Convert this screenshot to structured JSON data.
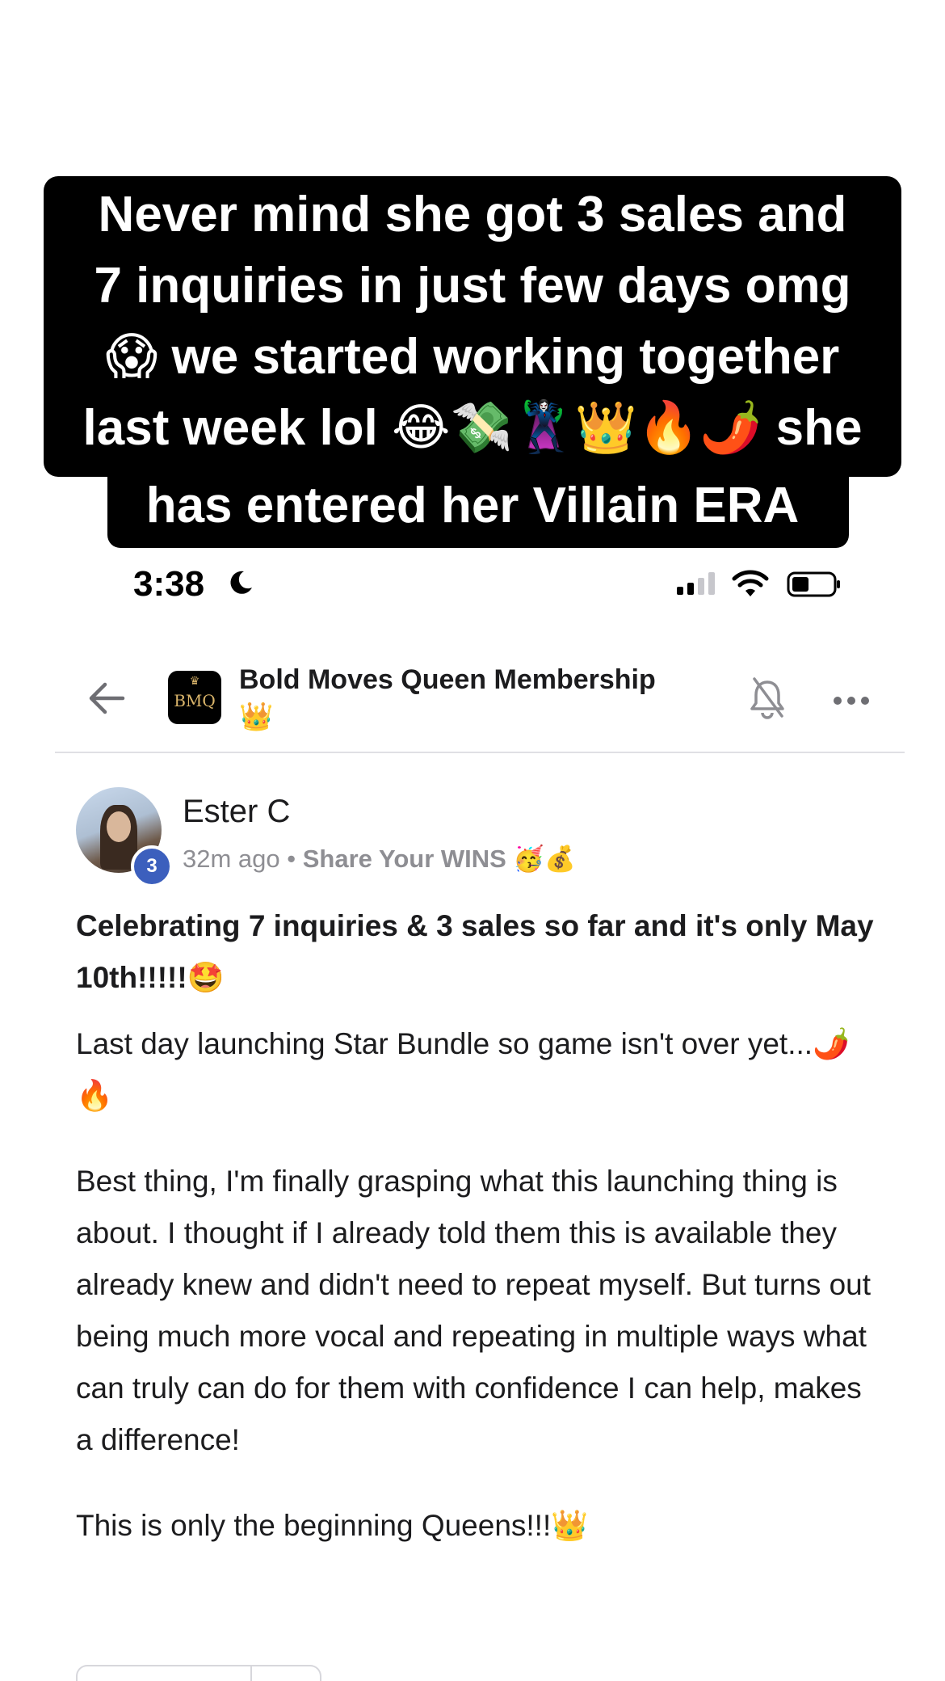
{
  "caption": {
    "lines": [
      "Never mind she got 3 sales and",
      "7 inquiries in just few days omg",
      "😱 we started working together",
      "last week lol 😂💸🦹‍♀️👑🔥🌶️ she",
      "has entered her Villain ERA"
    ]
  },
  "status_bar": {
    "time": "3:38"
  },
  "header": {
    "logo_text": "BMQ",
    "title": "Bold Moves Queen Membership 👑"
  },
  "post": {
    "author": "Ester C",
    "level": "3",
    "time_ago": "32m ago",
    "separator": " • ",
    "category": "Share Your WINS 🥳💰",
    "title": "Celebrating 7 inquiries & 3 sales so far and it's only May 10th!!!!!🤩",
    "paragraphs": [
      "Last day launching Star Bundle so game isn't over yet...🌶️🔥",
      "Best thing, I'm finally grasping what this launching thing is about. I thought if I already told them this is available they already knew and didn't need to repeat myself. But turns out being much more vocal and repeating in multiple ways what can truly can do for them with confidence I can help, makes a difference!",
      "This is only the beginning Queens!!!👑"
    ]
  },
  "colors": {
    "caption_bg": "#000000",
    "caption_text": "#ffffff",
    "level_badge": "#3c5fbd",
    "meta_text": "#8e8e93",
    "divider": "#e0e0e4"
  },
  "icons": [
    "moon-icon",
    "signal-icon",
    "wifi-icon",
    "battery-icon",
    "back-arrow-icon",
    "group-logo",
    "bell-off-icon",
    "more-icon"
  ]
}
